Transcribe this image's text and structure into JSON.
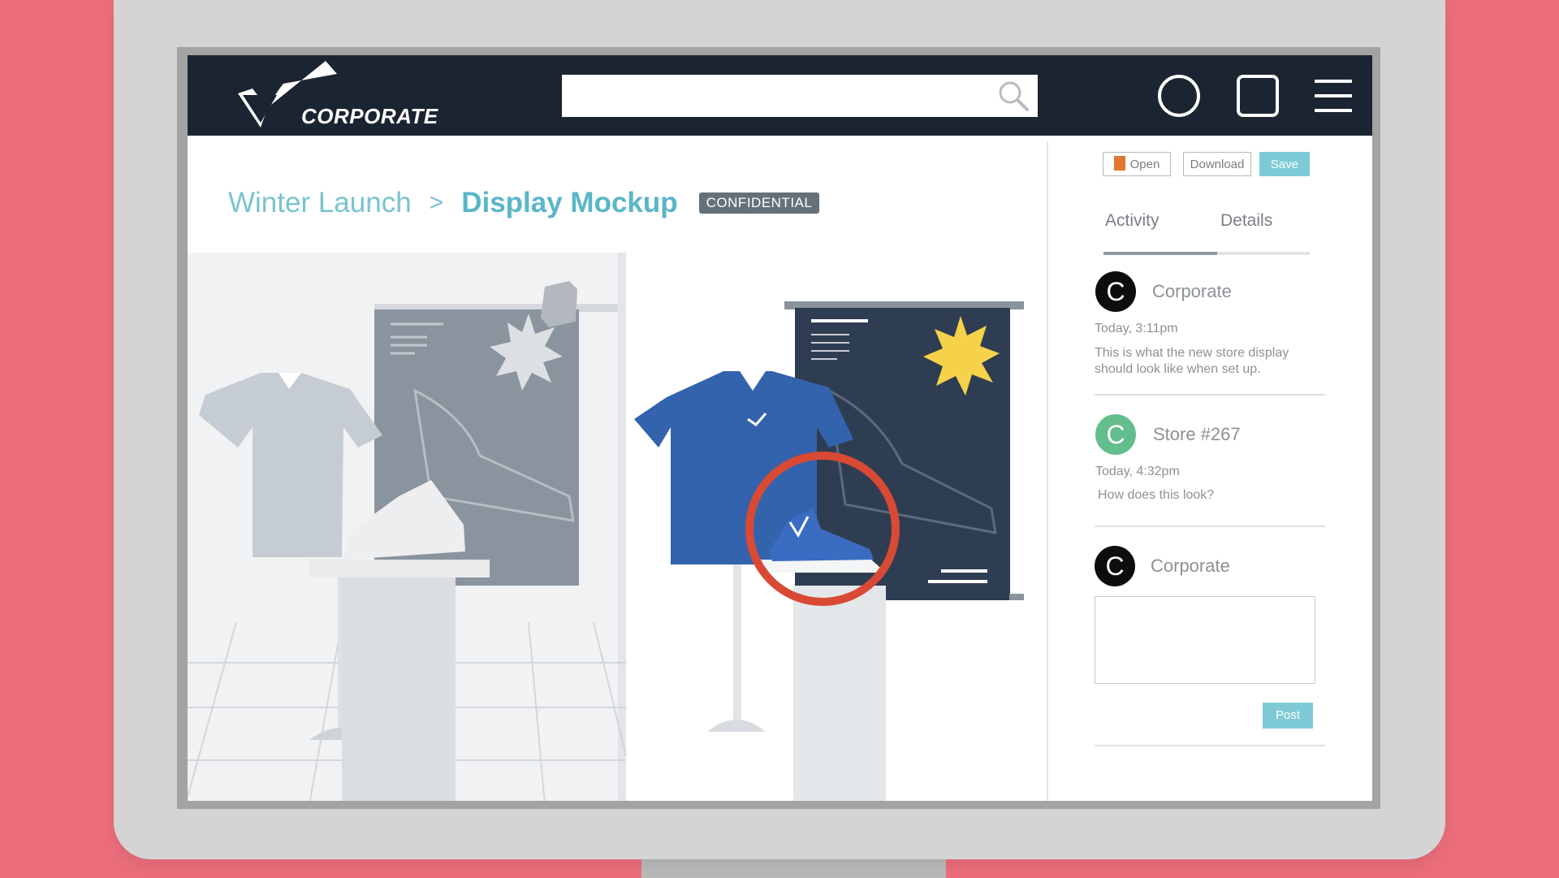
{
  "brand": {
    "name": "CORPORATE"
  },
  "search": {
    "placeholder": ""
  },
  "nav_icons": [
    "circle-icon",
    "square-icon",
    "hamburger-menu-icon"
  ],
  "breadcrumb": {
    "parent": "Winter Launch",
    "separator": ">",
    "current": "Display Mockup",
    "badge": "CONFIDENTIAL"
  },
  "toolbar": {
    "open_label": "Open",
    "download_label": "Download",
    "save_label": "Save"
  },
  "tabs": [
    {
      "label": "Activity",
      "active": true
    },
    {
      "label": "Details",
      "active": false
    }
  ],
  "activity": [
    {
      "avatar_letter": "C",
      "author": "Corporate",
      "time": "Today, 3:11pm",
      "message": "This is what the new store display should look like when set up.",
      "avatar_color": "#0d0d0d"
    },
    {
      "avatar_letter": "C",
      "author": "Store #267",
      "time": "Today, 4:32pm",
      "message": "How does this look?",
      "avatar_color": "#63bd8c"
    }
  ],
  "reply": {
    "avatar_letter": "C",
    "author": "Corporate",
    "value": "",
    "post_label": "Post"
  },
  "colors": {
    "background": "#ec6e7c",
    "topbar": "#1b2431",
    "accent": "#7ecbd7",
    "highlight_circle": "#d84a33",
    "shirt_blue": "#3363ad",
    "banner_dark": "#2f3d52",
    "star_yellow": "#f6d24a"
  }
}
